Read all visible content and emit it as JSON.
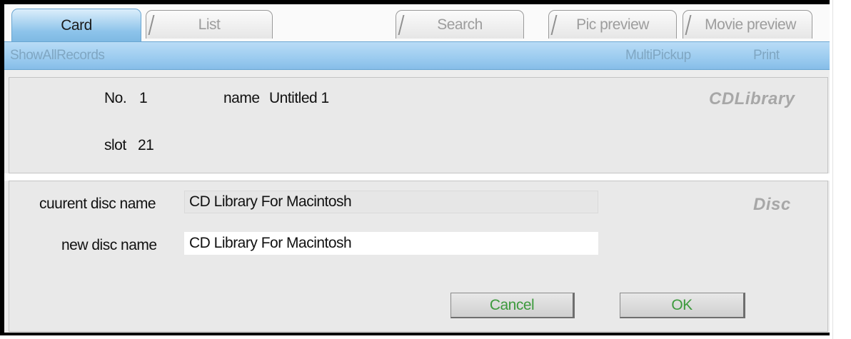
{
  "tabs": [
    {
      "id": "card",
      "label": "Card",
      "active": true
    },
    {
      "id": "list",
      "label": "List",
      "active": false
    },
    {
      "id": "search",
      "label": "Search",
      "active": false
    },
    {
      "id": "pic_preview",
      "label": "Pic preview",
      "active": false
    },
    {
      "id": "movie_preview",
      "label": "Movie preview",
      "active": false
    }
  ],
  "toolbar": {
    "show_all_records": "ShowAllRecords",
    "multi_pickup": "MultiPickup",
    "print": "Print"
  },
  "record": {
    "section_title": "CDLibrary",
    "no_label": "No.",
    "no_value": "1",
    "name_label": "name",
    "name_value": "Untitled 1",
    "slot_label": "slot",
    "slot_value": "21"
  },
  "disc": {
    "section_title": "Disc",
    "current_label": "cuurent disc name",
    "current_value": "CD Library For Macintosh",
    "new_label": "new disc name",
    "new_value": "CD Library For Macintosh",
    "cancel_label": "Cancel",
    "ok_label": "OK"
  },
  "colors": {
    "active_tab": "#8cc3ea",
    "toolbar": "#9bcbef",
    "button_text": "#3d9a3d",
    "section_title": "#a7a7a7"
  }
}
